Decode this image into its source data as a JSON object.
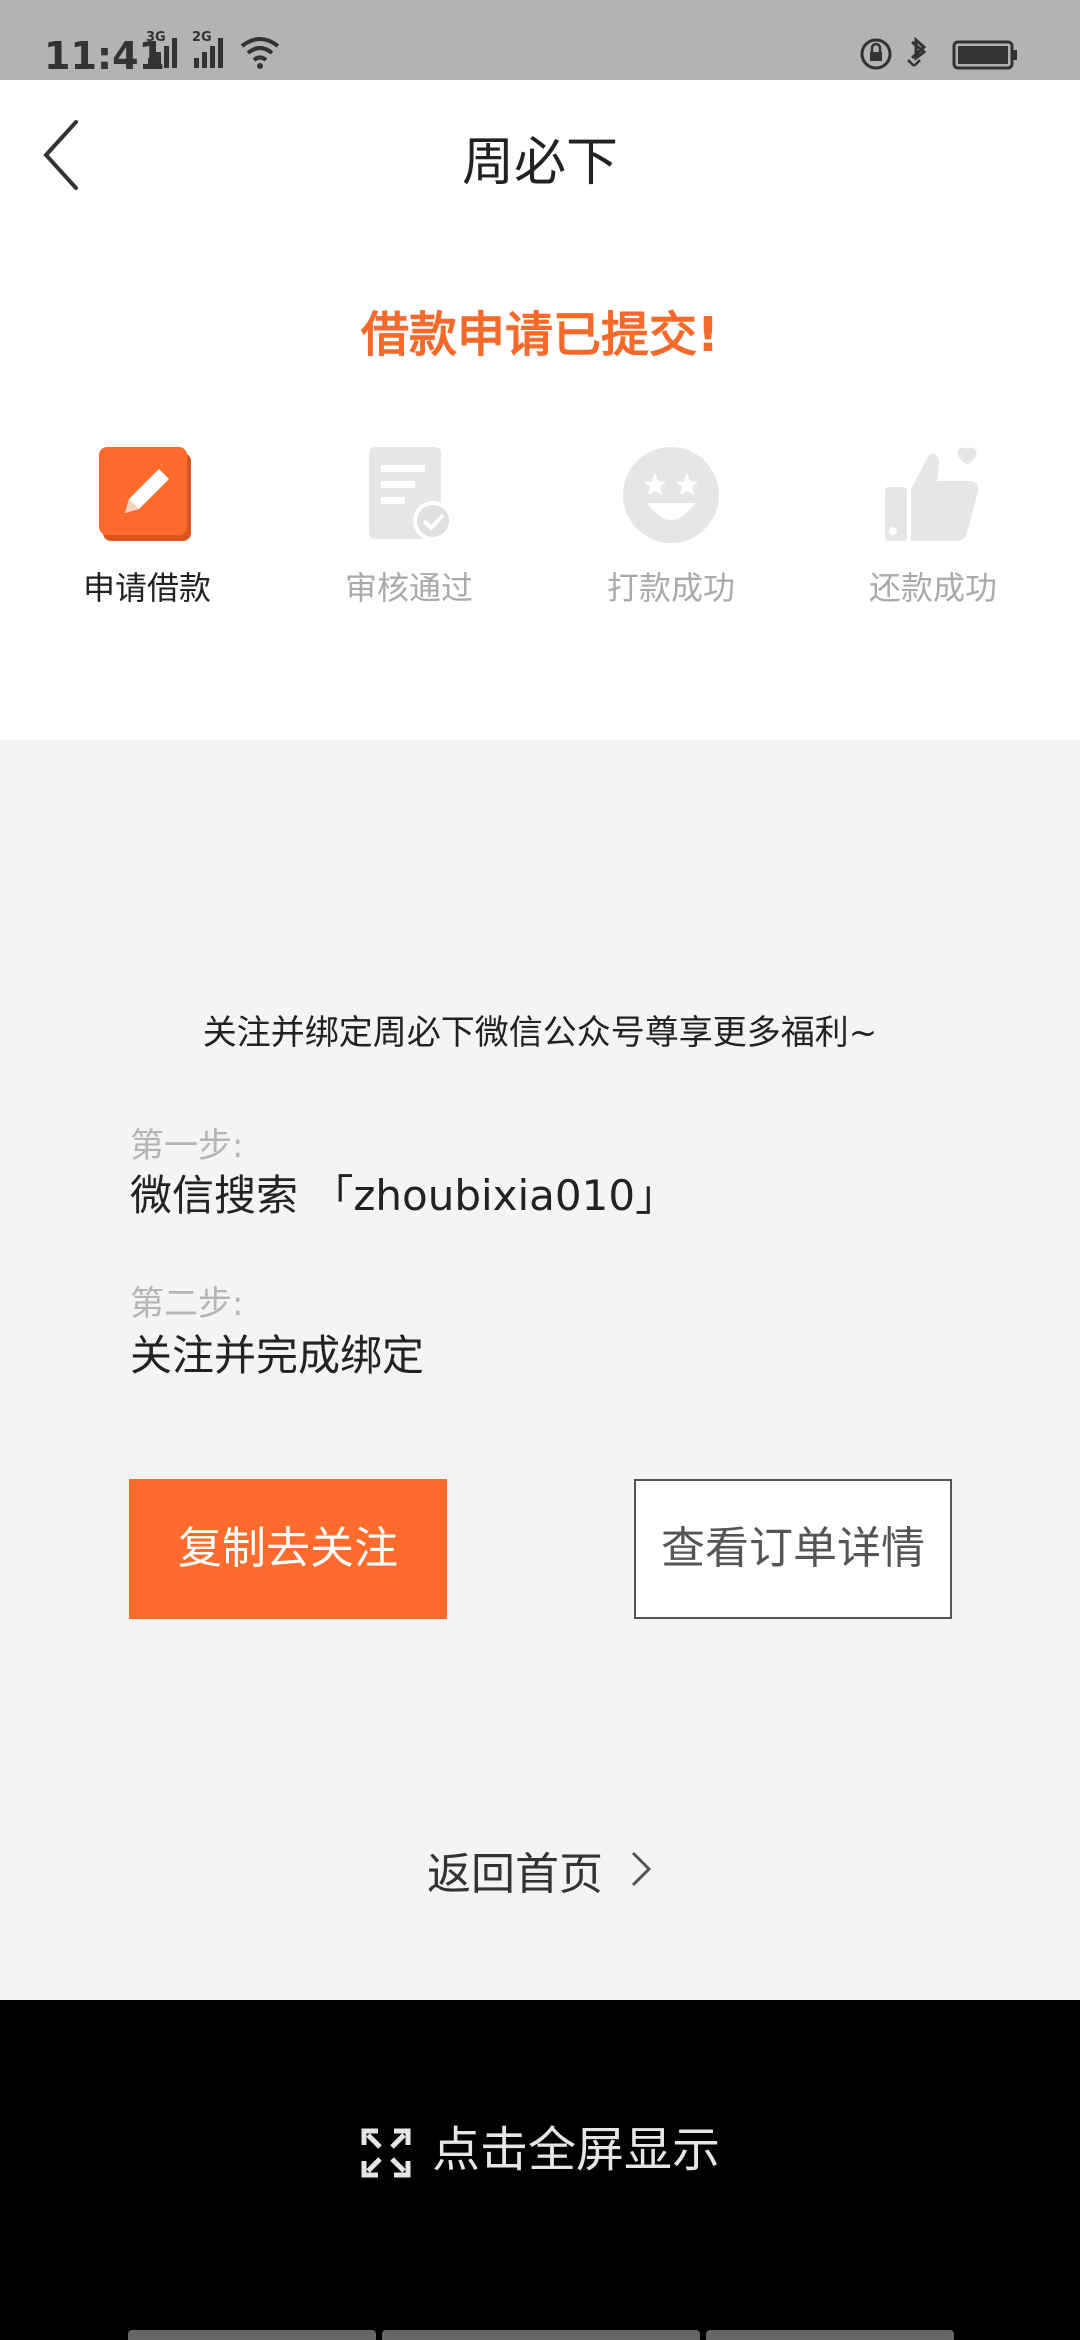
{
  "status": {
    "time": "11:41",
    "signal1": "3G",
    "signal2": "2G"
  },
  "header": {
    "title": "周必下",
    "submitted": "借款申请已提交!"
  },
  "steps": [
    {
      "label": "申请借款",
      "icon": "pencil-note-icon",
      "active": true
    },
    {
      "label": "审核通过",
      "icon": "document-check-icon",
      "active": false
    },
    {
      "label": "打款成功",
      "icon": "star-eyes-smile-icon",
      "active": false
    },
    {
      "label": "还款成功",
      "icon": "thumbs-up-icon",
      "active": false
    }
  ],
  "promo": "关注并绑定周必下微信公众号尊享更多福利~",
  "guide": {
    "step1_hint": "第一步:",
    "step1_text": "微信搜索 「zhoubixia010」",
    "step2_hint": "第二步:",
    "step2_text": "关注并完成绑定"
  },
  "buttons": {
    "copy": "复制去关注",
    "order": "查看订单详情"
  },
  "back_home": "返回首页",
  "fullscreen": "点击全屏显示",
  "colors": {
    "accent": "#ff6b2c",
    "title_orange": "#f56a2a",
    "inactive": "#aaaaaa"
  }
}
